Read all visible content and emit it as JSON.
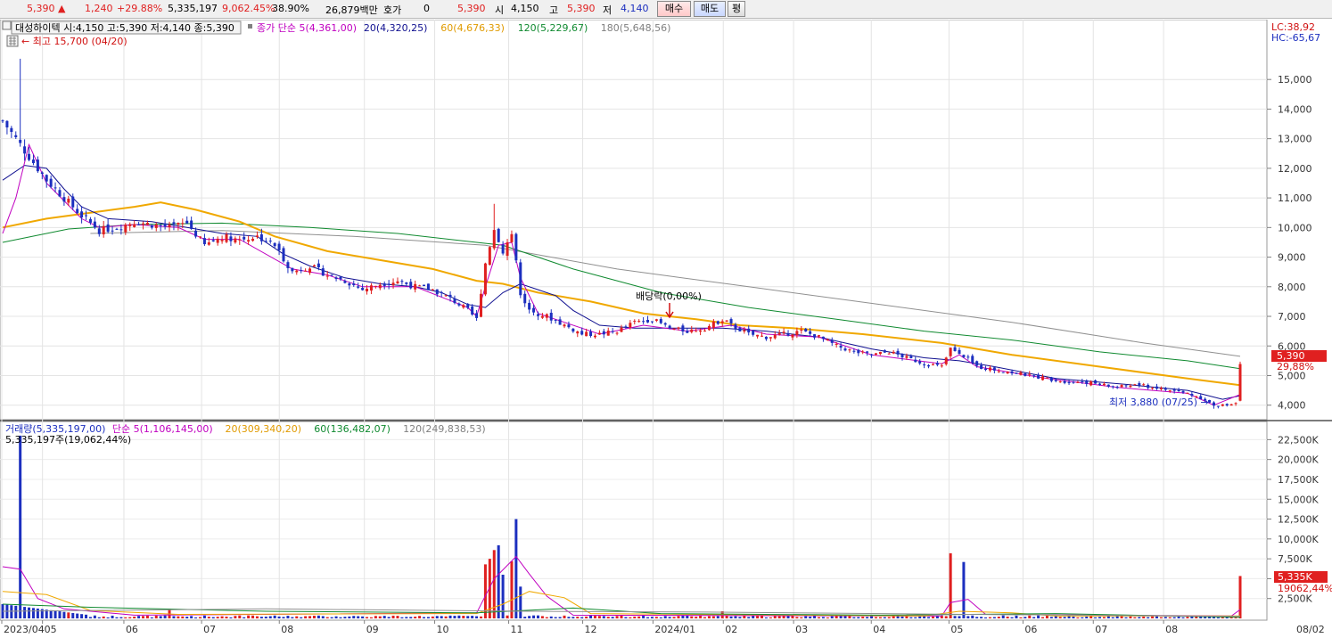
{
  "colors": {
    "up": "#e02020",
    "down": "#1c2fbf",
    "ma5": "#c000c0",
    "ma20": "#101090",
    "ma60": "#f0a800",
    "ma120": "#108a30",
    "ma180": "#909090"
  },
  "topbar": {
    "price": "5,390",
    "price_arrow": "▲",
    "change": "1,240",
    "change_pct": "+29.88%",
    "volume": "5,335,197",
    "volume_pct": "9,062.45%",
    "turnover": "38.90%",
    "amount": "26,879백만",
    "hoga_label": "호가",
    "hoga_value": "0",
    "hoga_price": "5,390",
    "open_label": "시",
    "open_value": "4,150",
    "high_label": "고",
    "high_value": "5,390",
    "low_label": "저",
    "low_value": "4,140",
    "buy_label": "매수",
    "sell_label": "매도",
    "eval_label": "평"
  },
  "price_panel": {
    "info_box": "대성하이텍 시:4,150 고:5,390 저:4,140 종:5,390",
    "ma_legend": [
      {
        "label": "종가 단순 5(4,361,00)",
        "color": "#c000c0"
      },
      {
        "label": "20(4,320,25)",
        "color": "#101090"
      },
      {
        "label": "60(4,676,33)",
        "color": "#e09a00"
      },
      {
        "label": "120(5,229,67)",
        "color": "#108a30"
      },
      {
        "label": "180(5,648,56)",
        "color": "#808080"
      }
    ],
    "high_marker": "최고 15,700 (04/20)",
    "low_marker": "최저 3,880 (07/25)",
    "dividend_marker": "배당락(0,00%)",
    "lc": "LC:38,92",
    "hc": "HC:-65,67",
    "current_tag": "5,390",
    "current_pct": "29,88%",
    "y_ticks": [
      "15,000",
      "14,000",
      "13,000",
      "12,000",
      "11,000",
      "10,000",
      "9,000",
      "8,000",
      "7,000",
      "6,000",
      "5,000",
      "4,000"
    ]
  },
  "volume_panel": {
    "legend": [
      {
        "label": "거래량(5,335,197,00)",
        "color": "#1c2fbf"
      },
      {
        "label": "단순 5(1,106,145,00)",
        "color": "#c000c0"
      },
      {
        "label": "20(309,340,20)",
        "color": "#e09a00"
      },
      {
        "label": "60(136,482,07)",
        "color": "#108a30"
      },
      {
        "label": "120(249,838,53)",
        "color": "#808080"
      }
    ],
    "info": "5,335,197주(19,062,44%)",
    "current_tag": "5,335K",
    "current_pct": "19062,44%",
    "y_ticks": [
      "22,500K",
      "20,000K",
      "17,500K",
      "15,000K",
      "12,500K",
      "10,000K",
      "7,500K",
      "5,000K",
      "2,500K"
    ]
  },
  "x_axis": [
    "2023/04",
    "05",
    "06",
    "07",
    "08",
    "09",
    "10",
    "11",
    "12",
    "2024/01",
    "02",
    "03",
    "04",
    "05",
    "06",
    "07",
    "08",
    "08/02"
  ],
  "chart_data": {
    "type": "candlestick",
    "price_range": [
      3600,
      16300
    ],
    "volume_range_k": [
      0,
      24000
    ],
    "price_path": [
      [
        0,
        13600
      ],
      [
        3,
        13000
      ],
      [
        6,
        12400
      ],
      [
        10,
        11600
      ],
      [
        14,
        11000
      ],
      [
        18,
        10400
      ],
      [
        22,
        9900
      ],
      [
        26,
        10000
      ],
      [
        30,
        10200
      ],
      [
        34,
        10100
      ],
      [
        38,
        10000
      ],
      [
        42,
        10150
      ],
      [
        46,
        9400
      ],
      [
        50,
        9700
      ],
      [
        54,
        9600
      ],
      [
        58,
        9700
      ],
      [
        62,
        9400
      ],
      [
        66,
        8500
      ],
      [
        70,
        8700
      ],
      [
        74,
        8400
      ],
      [
        78,
        8200
      ],
      [
        82,
        7900
      ],
      [
        86,
        8100
      ],
      [
        90,
        8200
      ],
      [
        94,
        8000
      ],
      [
        98,
        7900
      ],
      [
        102,
        7600
      ],
      [
        106,
        7200
      ],
      [
        108,
        6900
      ],
      [
        110,
        8800
      ],
      [
        112,
        10000
      ],
      [
        114,
        9200
      ],
      [
        116,
        9800
      ],
      [
        118,
        7800
      ],
      [
        120,
        7200
      ],
      [
        124,
        7000
      ],
      [
        128,
        6700
      ],
      [
        132,
        6400
      ],
      [
        136,
        6400
      ],
      [
        140,
        6500
      ],
      [
        144,
        6800
      ],
      [
        148,
        6900
      ],
      [
        152,
        6600
      ],
      [
        156,
        6500
      ],
      [
        160,
        6600
      ],
      [
        164,
        6900
      ],
      [
        166,
        6700
      ],
      [
        170,
        6400
      ],
      [
        174,
        6300
      ],
      [
        178,
        6400
      ],
      [
        182,
        6500
      ],
      [
        186,
        6300
      ],
      [
        190,
        6000
      ],
      [
        194,
        5800
      ],
      [
        198,
        5700
      ],
      [
        202,
        5800
      ],
      [
        206,
        5600
      ],
      [
        210,
        5400
      ],
      [
        214,
        5300
      ],
      [
        216,
        5900
      ],
      [
        218,
        5800
      ],
      [
        222,
        5300
      ],
      [
        226,
        5200
      ],
      [
        230,
        5100
      ],
      [
        234,
        5000
      ],
      [
        238,
        4900
      ],
      [
        242,
        4800
      ],
      [
        246,
        4800
      ],
      [
        250,
        4700
      ],
      [
        254,
        4600
      ],
      [
        258,
        4700
      ],
      [
        262,
        4600
      ],
      [
        266,
        4500
      ],
      [
        270,
        4400
      ],
      [
        274,
        4200
      ],
      [
        276,
        3950
      ],
      [
        280,
        4050
      ],
      [
        282,
        4150
      ]
    ],
    "volume_spikes": [
      [
        4,
        23000
      ],
      [
        38,
        1200
      ],
      [
        110,
        6800
      ],
      [
        111,
        7500
      ],
      [
        112,
        8600
      ],
      [
        113,
        9200
      ],
      [
        114,
        5500
      ],
      [
        116,
        7200
      ],
      [
        117,
        12500
      ],
      [
        118,
        4000
      ],
      [
        164,
        900
      ],
      [
        216,
        8200
      ],
      [
        219,
        7100
      ],
      [
        282,
        5335
      ]
    ],
    "ma5": [
      [
        0,
        9800
      ],
      [
        3,
        11000
      ],
      [
        6,
        12800
      ],
      [
        10,
        11500
      ],
      [
        14,
        10900
      ],
      [
        18,
        10300
      ],
      [
        22,
        10000
      ],
      [
        30,
        10100
      ],
      [
        40,
        10000
      ],
      [
        46,
        9600
      ],
      [
        54,
        9600
      ],
      [
        66,
        8600
      ],
      [
        74,
        8400
      ],
      [
        82,
        8000
      ],
      [
        94,
        8000
      ],
      [
        106,
        7300
      ],
      [
        108,
        7000
      ],
      [
        110,
        8000
      ],
      [
        113,
        9400
      ],
      [
        116,
        9500
      ],
      [
        118,
        8300
      ],
      [
        122,
        7100
      ],
      [
        128,
        6800
      ],
      [
        136,
        6400
      ],
      [
        146,
        6700
      ],
      [
        156,
        6500
      ],
      [
        166,
        6700
      ],
      [
        174,
        6400
      ],
      [
        186,
        6300
      ],
      [
        198,
        5700
      ],
      [
        214,
        5400
      ],
      [
        218,
        5700
      ],
      [
        222,
        5300
      ],
      [
        238,
        4900
      ],
      [
        254,
        4600
      ],
      [
        270,
        4400
      ],
      [
        276,
        4000
      ],
      [
        282,
        4361
      ]
    ],
    "ma20": [
      [
        0,
        11600
      ],
      [
        5,
        12100
      ],
      [
        10,
        12000
      ],
      [
        14,
        11300
      ],
      [
        18,
        10700
      ],
      [
        24,
        10300
      ],
      [
        34,
        10200
      ],
      [
        42,
        10000
      ],
      [
        50,
        9800
      ],
      [
        58,
        9700
      ],
      [
        64,
        9100
      ],
      [
        70,
        8700
      ],
      [
        78,
        8300
      ],
      [
        86,
        8100
      ],
      [
        94,
        8000
      ],
      [
        100,
        7800
      ],
      [
        106,
        7400
      ],
      [
        110,
        7300
      ],
      [
        114,
        7800
      ],
      [
        118,
        8100
      ],
      [
        122,
        7900
      ],
      [
        126,
        7700
      ],
      [
        130,
        7200
      ],
      [
        136,
        6700
      ],
      [
        144,
        6600
      ],
      [
        152,
        6600
      ],
      [
        164,
        6600
      ],
      [
        174,
        6500
      ],
      [
        186,
        6300
      ],
      [
        198,
        5900
      ],
      [
        210,
        5600
      ],
      [
        218,
        5500
      ],
      [
        226,
        5300
      ],
      [
        240,
        4900
      ],
      [
        256,
        4700
      ],
      [
        270,
        4500
      ],
      [
        278,
        4200
      ],
      [
        282,
        4320
      ]
    ],
    "ma60": [
      [
        0,
        10000
      ],
      [
        10,
        10300
      ],
      [
        20,
        10500
      ],
      [
        30,
        10700
      ],
      [
        36,
        10850
      ],
      [
        44,
        10600
      ],
      [
        54,
        10200
      ],
      [
        62,
        9700
      ],
      [
        74,
        9200
      ],
      [
        86,
        8900
      ],
      [
        98,
        8600
      ],
      [
        108,
        8200
      ],
      [
        114,
        8100
      ],
      [
        122,
        7800
      ],
      [
        134,
        7500
      ],
      [
        146,
        7100
      ],
      [
        158,
        6900
      ],
      [
        168,
        6700
      ],
      [
        180,
        6600
      ],
      [
        196,
        6400
      ],
      [
        214,
        6100
      ],
      [
        230,
        5700
      ],
      [
        250,
        5300
      ],
      [
        270,
        4900
      ],
      [
        282,
        4676
      ]
    ],
    "ma120": [
      [
        0,
        9500
      ],
      [
        15,
        9950
      ],
      [
        30,
        10100
      ],
      [
        50,
        10150
      ],
      [
        70,
        10000
      ],
      [
        90,
        9800
      ],
      [
        108,
        9500
      ],
      [
        114,
        9400
      ],
      [
        130,
        8600
      ],
      [
        150,
        7800
      ],
      [
        170,
        7300
      ],
      [
        190,
        6900
      ],
      [
        210,
        6500
      ],
      [
        230,
        6200
      ],
      [
        250,
        5800
      ],
      [
        270,
        5500
      ],
      [
        282,
        5230
      ]
    ],
    "ma180": [
      [
        20,
        9800
      ],
      [
        50,
        9900
      ],
      [
        80,
        9700
      ],
      [
        110,
        9400
      ],
      [
        140,
        8600
      ],
      [
        170,
        8000
      ],
      [
        200,
        7400
      ],
      [
        230,
        6800
      ],
      [
        260,
        6100
      ],
      [
        282,
        5650
      ]
    ]
  }
}
